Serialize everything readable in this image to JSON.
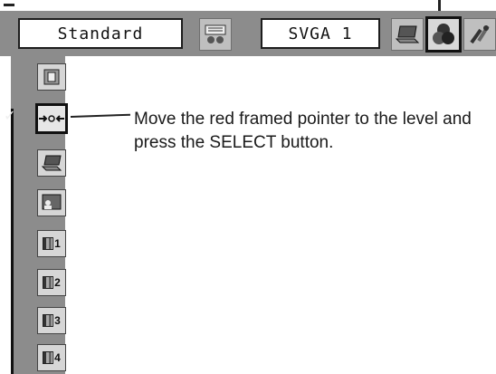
{
  "top_bar": {
    "mode_label": "Standard",
    "input_label": "SVGA 1"
  },
  "colors": {
    "bar_gray": "#8c8c8c",
    "box_white": "#ffffff",
    "border_dark": "#1d1d1d"
  },
  "side_items": [
    {
      "icon": "picture-doc-icon",
      "label": ""
    },
    {
      "icon": "pointer-arrows-icon",
      "label": "",
      "selected": true
    },
    {
      "icon": "laptop-icon",
      "label": ""
    },
    {
      "icon": "screen-person-icon",
      "label": ""
    },
    {
      "icon": "color-bars-icon",
      "label": "1"
    },
    {
      "icon": "color-bars-icon",
      "label": "2"
    },
    {
      "icon": "color-bars-icon",
      "label": "3"
    },
    {
      "icon": "color-bars-icon",
      "label": "4"
    }
  ],
  "instruction": {
    "text": "Move the red framed pointer to the level and press the SELECT button."
  }
}
